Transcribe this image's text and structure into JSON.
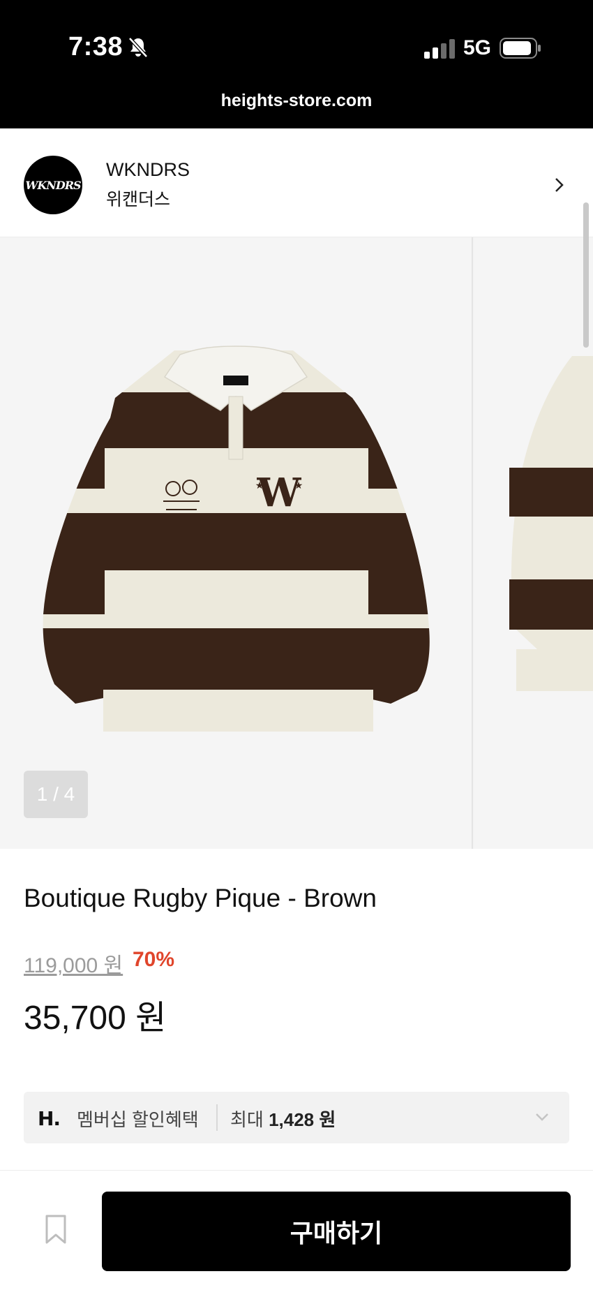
{
  "status_bar": {
    "time": "7:38",
    "network": "5G"
  },
  "browser": {
    "url": "heights-store.com"
  },
  "brand": {
    "logo_text": "WKNDRS",
    "name": "WKNDRS",
    "name_kr": "위캔더스"
  },
  "gallery": {
    "counter": "1 / 4",
    "current": 1,
    "total": 4
  },
  "product": {
    "title": "Boutique Rugby Pique - Brown",
    "original_price": "119,000 원",
    "discount": "70%",
    "price": "35,700 원"
  },
  "membership": {
    "logo": "H.",
    "label": "멤버십 할인혜택",
    "max_prefix": "최대",
    "max_amount": "1,428 원"
  },
  "actions": {
    "buy_label": "구매하기"
  },
  "colors": {
    "discount": "#e0452b",
    "button_bg": "#000000",
    "shirt_brown": "#3a2418",
    "shirt_cream": "#ece9dc"
  }
}
